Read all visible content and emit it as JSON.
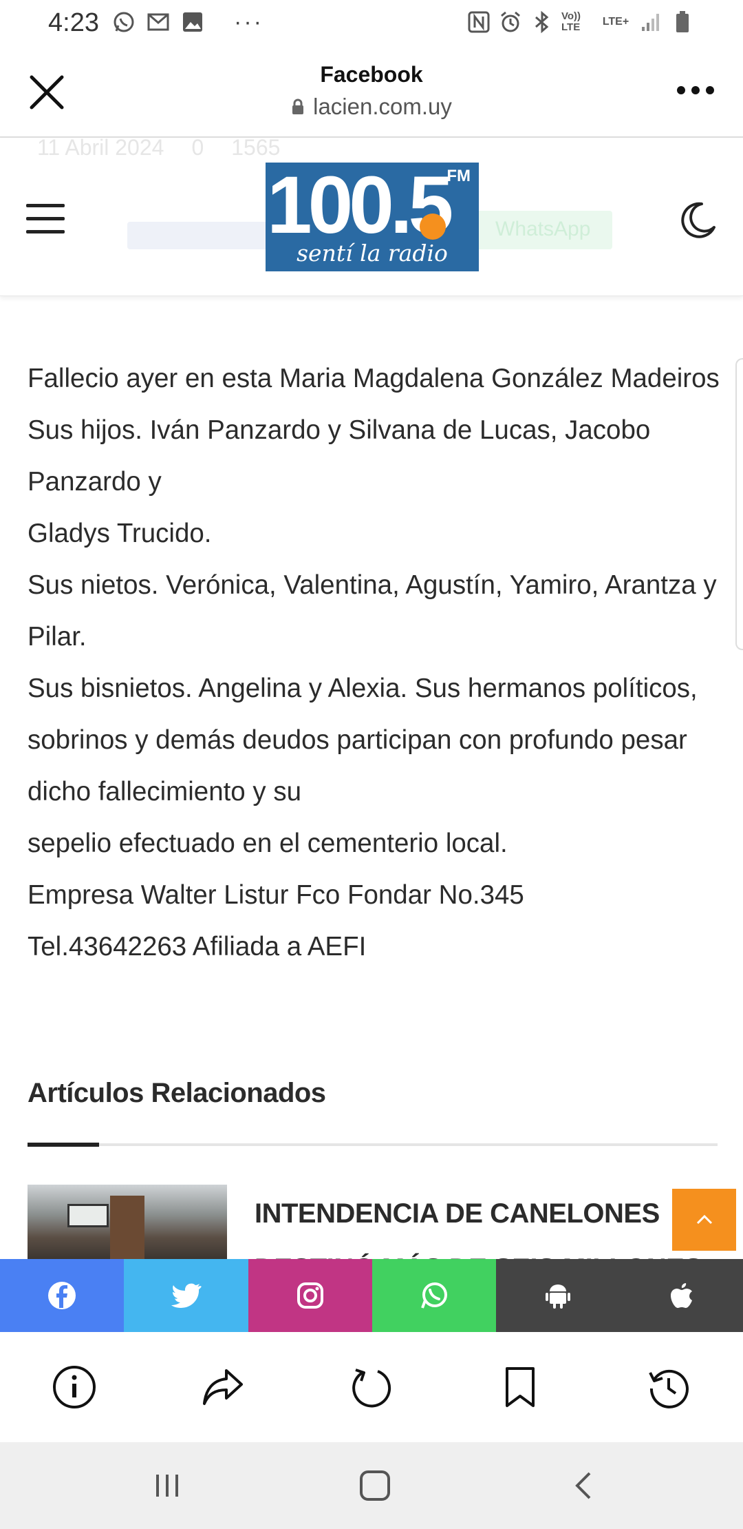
{
  "status_bar": {
    "time": "4:23",
    "left_icons": [
      "whatsapp-icon",
      "gmail-icon",
      "gallery-icon"
    ],
    "more": "···",
    "right_icons": [
      "nfc-icon",
      "alarm-icon",
      "bluetooth-icon",
      "volte-icon",
      "lte-icon",
      "signal-icon",
      "battery-icon"
    ],
    "volte_label": "Vo)) LTE",
    "lte_label": "LTE+"
  },
  "tab_header": {
    "title": "Facebook",
    "url": "lacien.com.uy"
  },
  "site_header": {
    "faded_date": "11 Abril 2024",
    "faded_comments": "0",
    "faded_views": "1565",
    "faded_whatsapp": "WhatsApp",
    "logo": {
      "number": "100.5",
      "fm": "FM",
      "tagline": "sentí la radio",
      "bg_color": "#2a6aa3",
      "accent": "#f5901e"
    }
  },
  "article": {
    "lines": [
      "Fallecio ayer en esta Maria Magdalena González Madeiros",
      "Sus hijos. Iván Panzardo y Silvana de Lucas, Jacobo Panzardo y",
      "Gladys Trucido.",
      "Sus nietos. Verónica, Valentina, Agustín, Yamiro, Arantza y Pilar.",
      "Sus bisnietos. Angelina y Alexia. Sus hermanos políticos, sobrinos y demás deudos participan con profundo pesar dicho fallecimiento y su",
      "sepelio efectuado en el cementerio local.",
      "Empresa Walter Listur Fco Fondar No.345",
      "Tel.43642263 Afiliada a AEFI"
    ]
  },
  "related": {
    "heading": "Artículos Relacionados",
    "items": [
      {
        "title": "INTENDENCIA DE CANELONES DESTINÓ MÁS DE SEIS MILLONES"
      }
    ]
  },
  "social_bar": {
    "buttons": [
      {
        "name": "facebook",
        "color": "#4a80f3"
      },
      {
        "name": "twitter",
        "color": "#44b6f0"
      },
      {
        "name": "instagram",
        "color": "#c13584"
      },
      {
        "name": "whatsapp",
        "color": "#41d160"
      },
      {
        "name": "android",
        "color": "#444444"
      },
      {
        "name": "apple",
        "color": "#444444"
      }
    ]
  },
  "browser_toolbar": {
    "buttons": [
      "info-icon",
      "share-icon",
      "refresh-icon",
      "bookmark-icon",
      "history-icon"
    ]
  },
  "system_nav": {
    "buttons": [
      "recents-icon",
      "home-icon",
      "back-icon"
    ]
  }
}
